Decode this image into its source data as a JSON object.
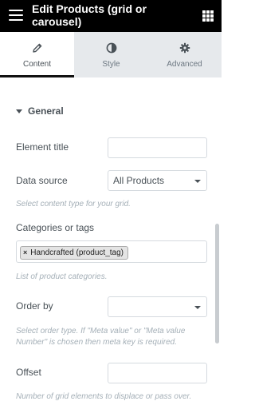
{
  "header": {
    "title": "Edit Products (grid or carousel)",
    "menu_icon": "hamburger-icon",
    "apps_icon": "grid-icon"
  },
  "tabs": [
    {
      "label": "Content",
      "icon": "pencil-icon",
      "active": true
    },
    {
      "label": "Style",
      "icon": "half-circle-icon",
      "active": false
    },
    {
      "label": "Advanced",
      "icon": "gear-icon",
      "active": false
    }
  ],
  "section": {
    "title": "General",
    "caret_icon": "caret-down-icon"
  },
  "fields": {
    "element_title": {
      "label": "Element title",
      "value": ""
    },
    "data_source": {
      "label": "Data source",
      "value": "All Products",
      "description": "Select content type for your grid."
    },
    "categories": {
      "label": "Categories or tags",
      "tag": "Handcrafted (product_tag)",
      "tag_remove": "×",
      "description": "List of product categories."
    },
    "order_by": {
      "label": "Order by",
      "value": "",
      "description": "Select order type. If \"Meta value\" or \"Meta value Number\" is chosen then meta key is required."
    },
    "offset": {
      "label": "Offset",
      "value": "",
      "description": "Number of grid elements to displace or pass over."
    }
  },
  "colors": {
    "header_bg": "#000000",
    "tab_bar_bg": "#e6e9ec",
    "text": "#495157",
    "muted": "#a4afb7"
  }
}
